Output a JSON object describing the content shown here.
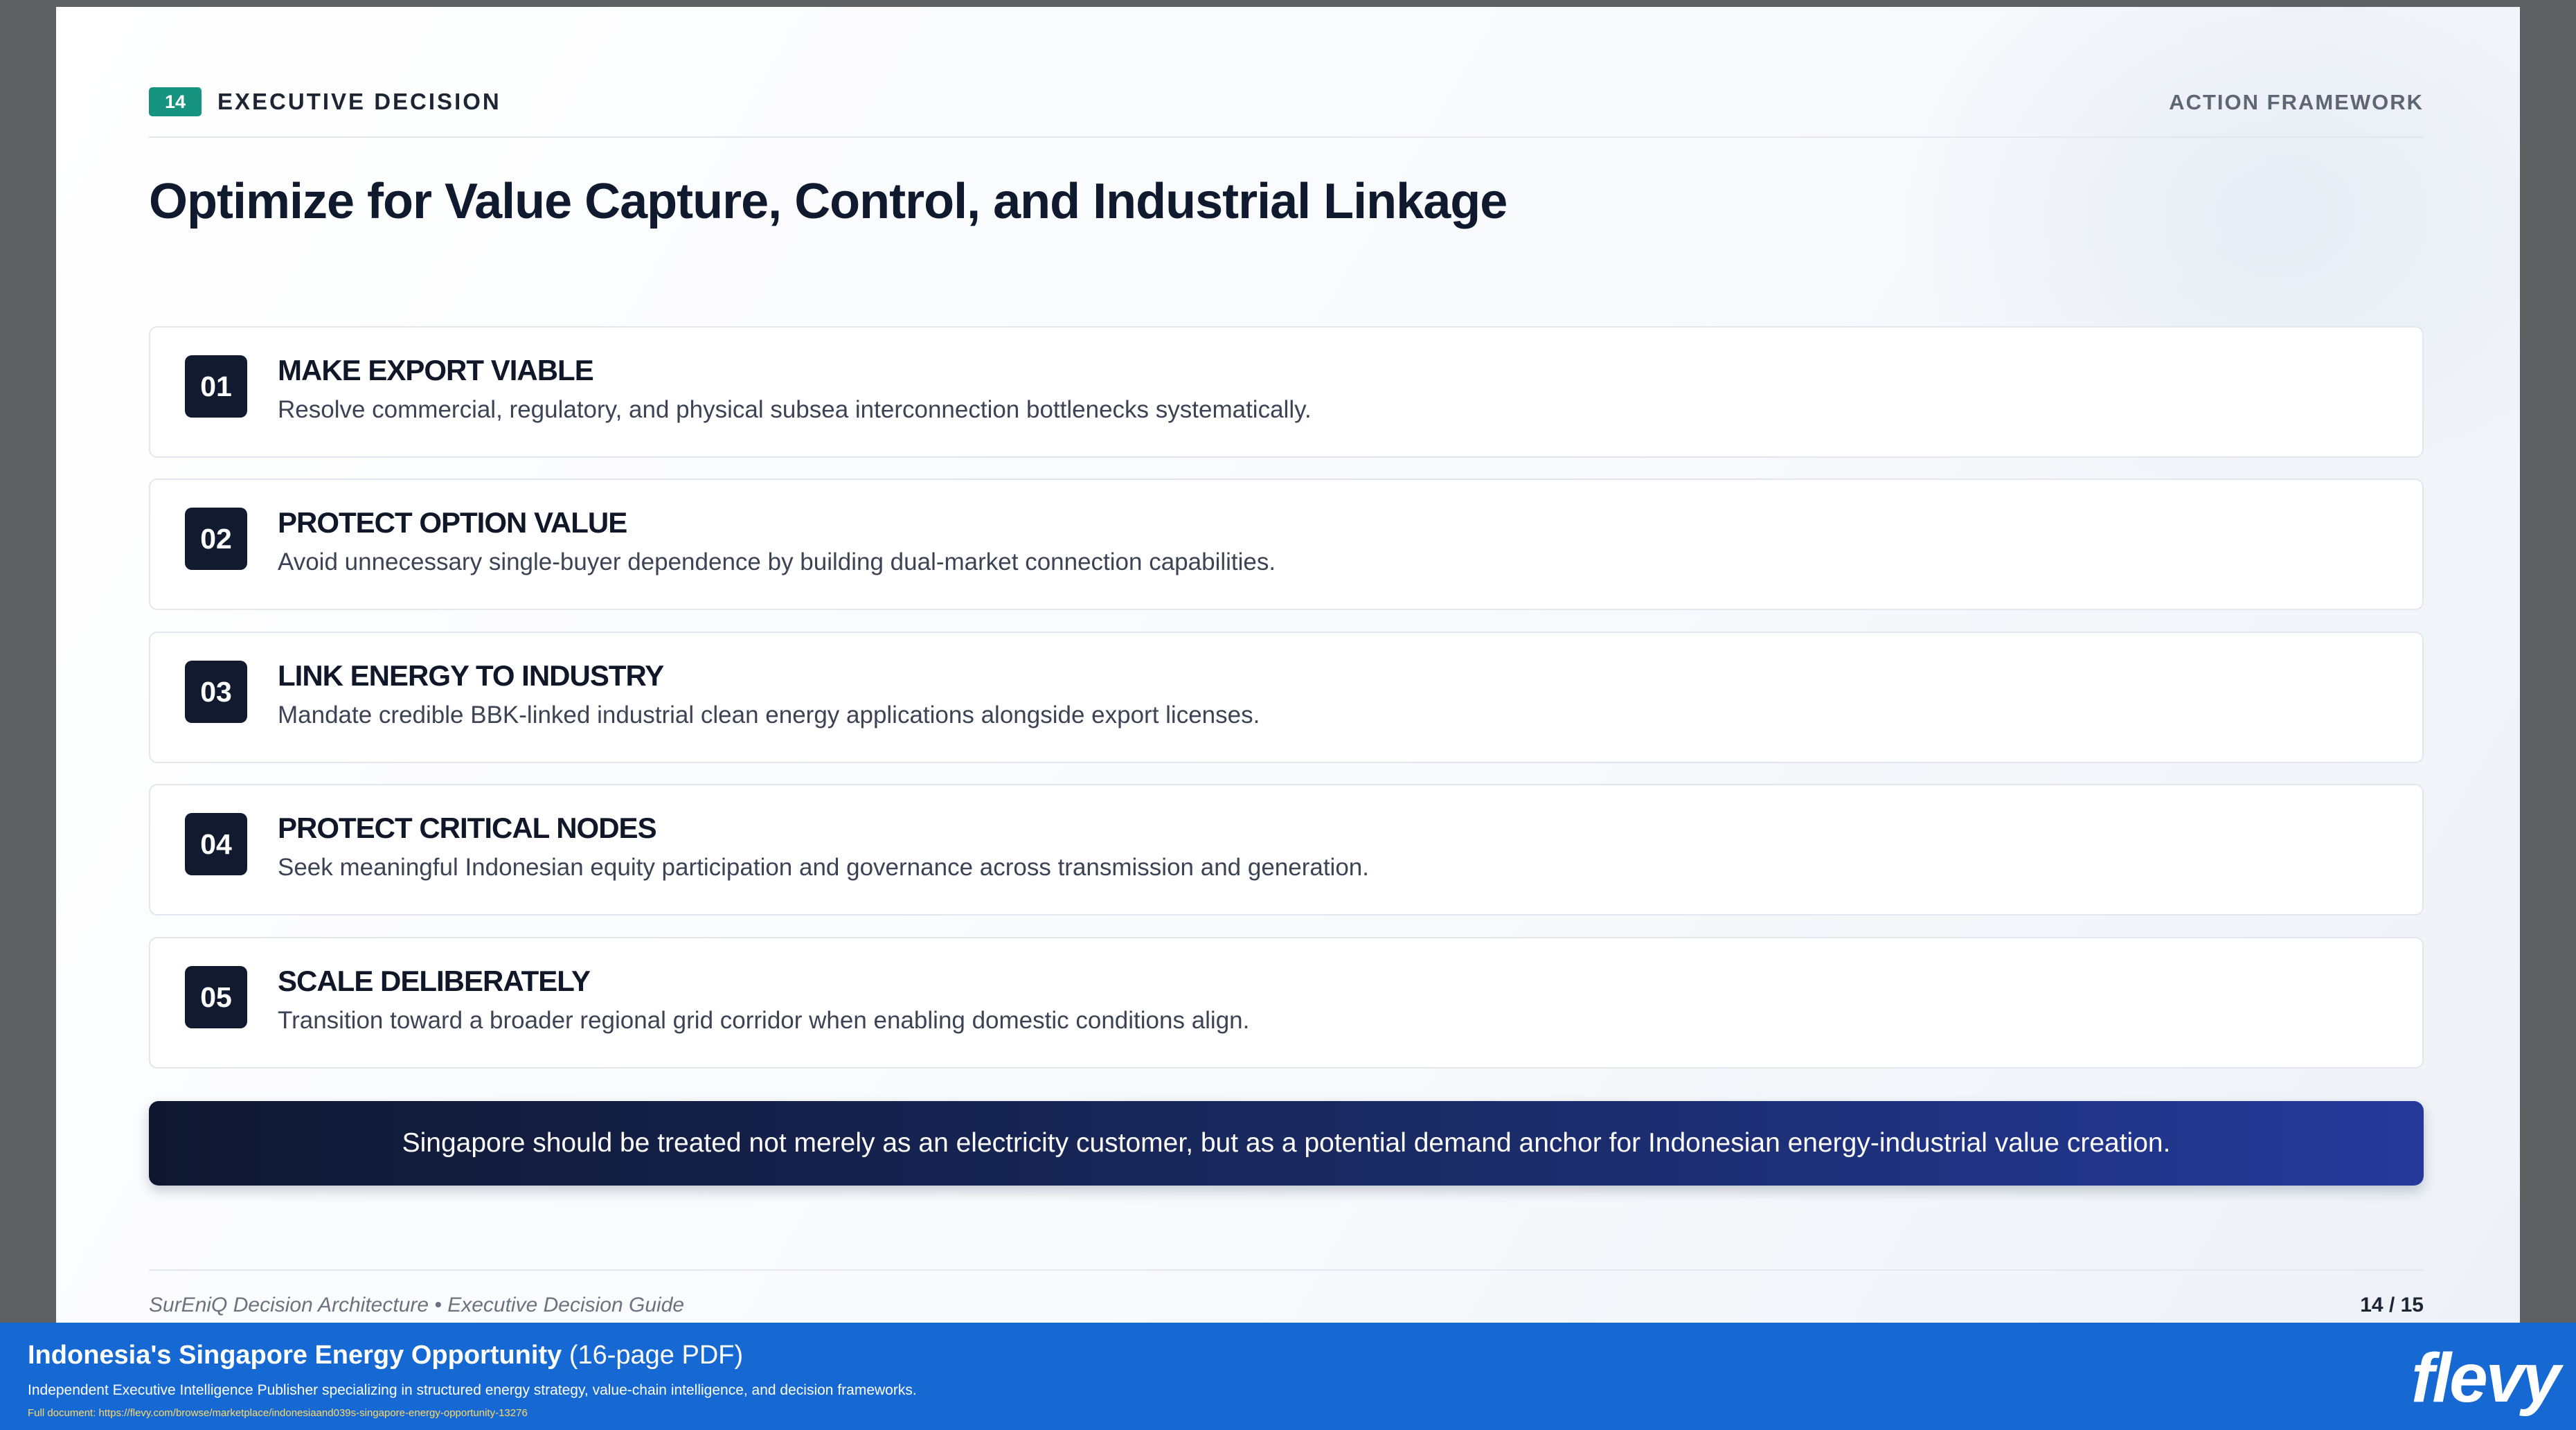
{
  "slide": {
    "badge": "14",
    "section_label": "EXECUTIVE DECISION",
    "framework_label": "ACTION FRAMEWORK",
    "title": "Optimize for Value Capture, Control, and Industrial Linkage",
    "items": [
      {
        "num": "01",
        "title": "MAKE EXPORT VIABLE",
        "desc": "Resolve commercial, regulatory, and physical subsea interconnection bottlenecks systematically."
      },
      {
        "num": "02",
        "title": "PROTECT OPTION VALUE",
        "desc": "Avoid unnecessary single-buyer dependence by building dual-market connection capabilities."
      },
      {
        "num": "03",
        "title": "LINK ENERGY TO INDUSTRY",
        "desc": "Mandate credible BBK-linked industrial clean energy applications alongside export licenses."
      },
      {
        "num": "04",
        "title": "PROTECT CRITICAL NODES",
        "desc": "Seek meaningful Indonesian equity participation and governance across transmission and generation."
      },
      {
        "num": "05",
        "title": "SCALE DELIBERATELY",
        "desc": "Transition toward a broader regional grid corridor when enabling domestic conditions align."
      }
    ],
    "banner": "Singapore should be treated not merely as an electricity customer, but as a potential demand anchor for Indonesian energy-industrial value creation.",
    "footer_left": "SurEniQ Decision Architecture • Executive Decision Guide",
    "page_indicator": "14 / 15"
  },
  "bottom_bar": {
    "title": "Indonesia's Singapore Energy Opportunity",
    "title_suffix": "(16-page PDF)",
    "subtitle": "Independent Executive Intelligence Publisher specializing in structured energy strategy, value-chain intelligence, and decision frameworks.",
    "link": "Full document: https://flevy.com/browse/marketplace/indonesiaand039s-singapore-energy-opportunity-13276",
    "logo": "flevy"
  },
  "colors": {
    "badge": "#17947f",
    "number_box": "#111a2e",
    "banner_start": "#0f1730",
    "banner_end": "#24399a",
    "bottom_bar": "#1669d3"
  }
}
